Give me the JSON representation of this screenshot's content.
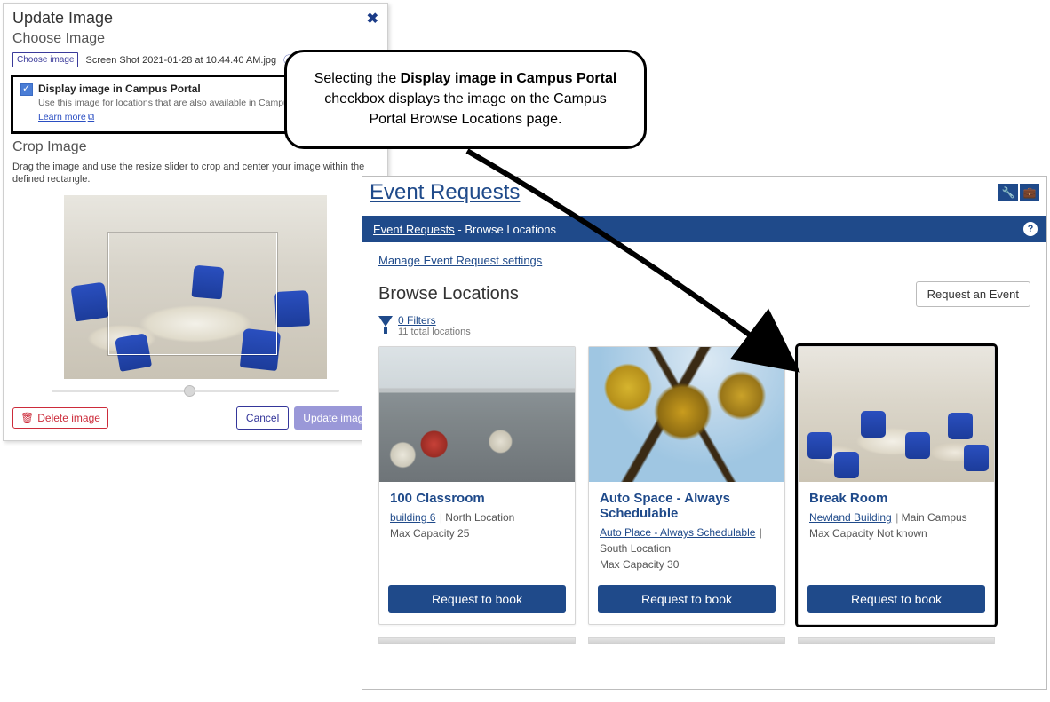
{
  "dialog": {
    "title": "Update Image",
    "choose_section": "Choose Image",
    "choose_button": "Choose image",
    "filename": "Screen Shot 2021-01-28 at 10.44.40 AM.jpg",
    "checkbox_label": "Display image in Campus Portal",
    "checkbox_desc": "Use this image for locations that are also available in Campus Portal.",
    "learn_more": "Learn more",
    "crop_section": "Crop Image",
    "crop_desc": "Drag the image and use the resize slider to crop and center your image within the defined rectangle.",
    "delete_btn": "Delete image",
    "cancel_btn": "Cancel",
    "update_btn": "Update image"
  },
  "callout": {
    "prefix": "Selecting the ",
    "bold": "Display image in Campus Portal",
    "suffix": " checkbox displays the image on the Campus Portal Browse Locations page."
  },
  "portal": {
    "title": "Event Requests",
    "breadcrumb_link": "Event Requests",
    "breadcrumb_current": "Browse Locations",
    "manage_link": "Manage Event Request settings",
    "browse_title": "Browse Locations",
    "request_event_btn": "Request an Event",
    "filters_count": "0 Filters",
    "filters_total": "11 total locations",
    "cards": [
      {
        "title": "100 Classroom",
        "building_link": "building 6",
        "location": "North Location",
        "capacity": "Max Capacity 25",
        "book_btn": "Request to book"
      },
      {
        "title": "Auto Space - Always Schedulable",
        "building_link": "Auto Place - Always Schedulable",
        "location": "South Location",
        "capacity": "Max Capacity 30",
        "book_btn": "Request to book"
      },
      {
        "title": "Break Room",
        "building_link": "Newland Building",
        "location": "Main Campus",
        "capacity": "Max Capacity Not known",
        "book_btn": "Request to book"
      }
    ]
  }
}
